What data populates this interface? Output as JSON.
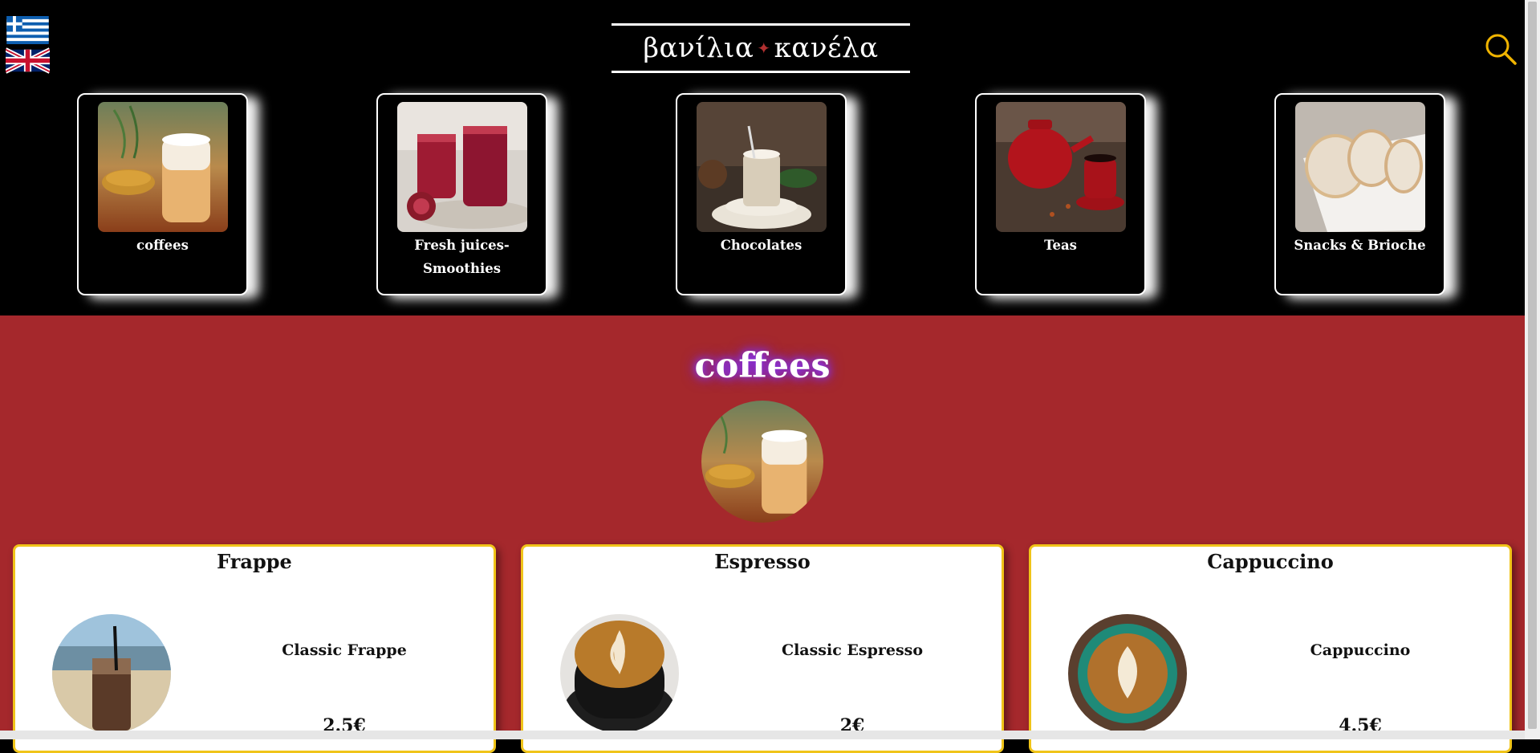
{
  "header": {
    "logo_left": "βανίλια",
    "logo_right": "κανέλα",
    "languages": [
      "Greek",
      "English"
    ]
  },
  "categories": [
    {
      "label": "coffees"
    },
    {
      "label": "Fresh juices-Smoothies"
    },
    {
      "label": "Chocolates"
    },
    {
      "label": "Teas"
    },
    {
      "label": "Snacks & Brioche"
    }
  ],
  "section": {
    "title": "coffees"
  },
  "products": [
    {
      "title": "Frappe",
      "name": "Classic Frappe",
      "price": "2.5€"
    },
    {
      "title": "Espresso",
      "name": "Classic Espresso",
      "price": "2€"
    },
    {
      "title": "Cappuccino",
      "name": "Cappuccino",
      "price": "4.5€"
    }
  ],
  "colors": {
    "accent": "#a5282c",
    "border_gold": "#f0c419",
    "search_icon": "#f0b400"
  }
}
